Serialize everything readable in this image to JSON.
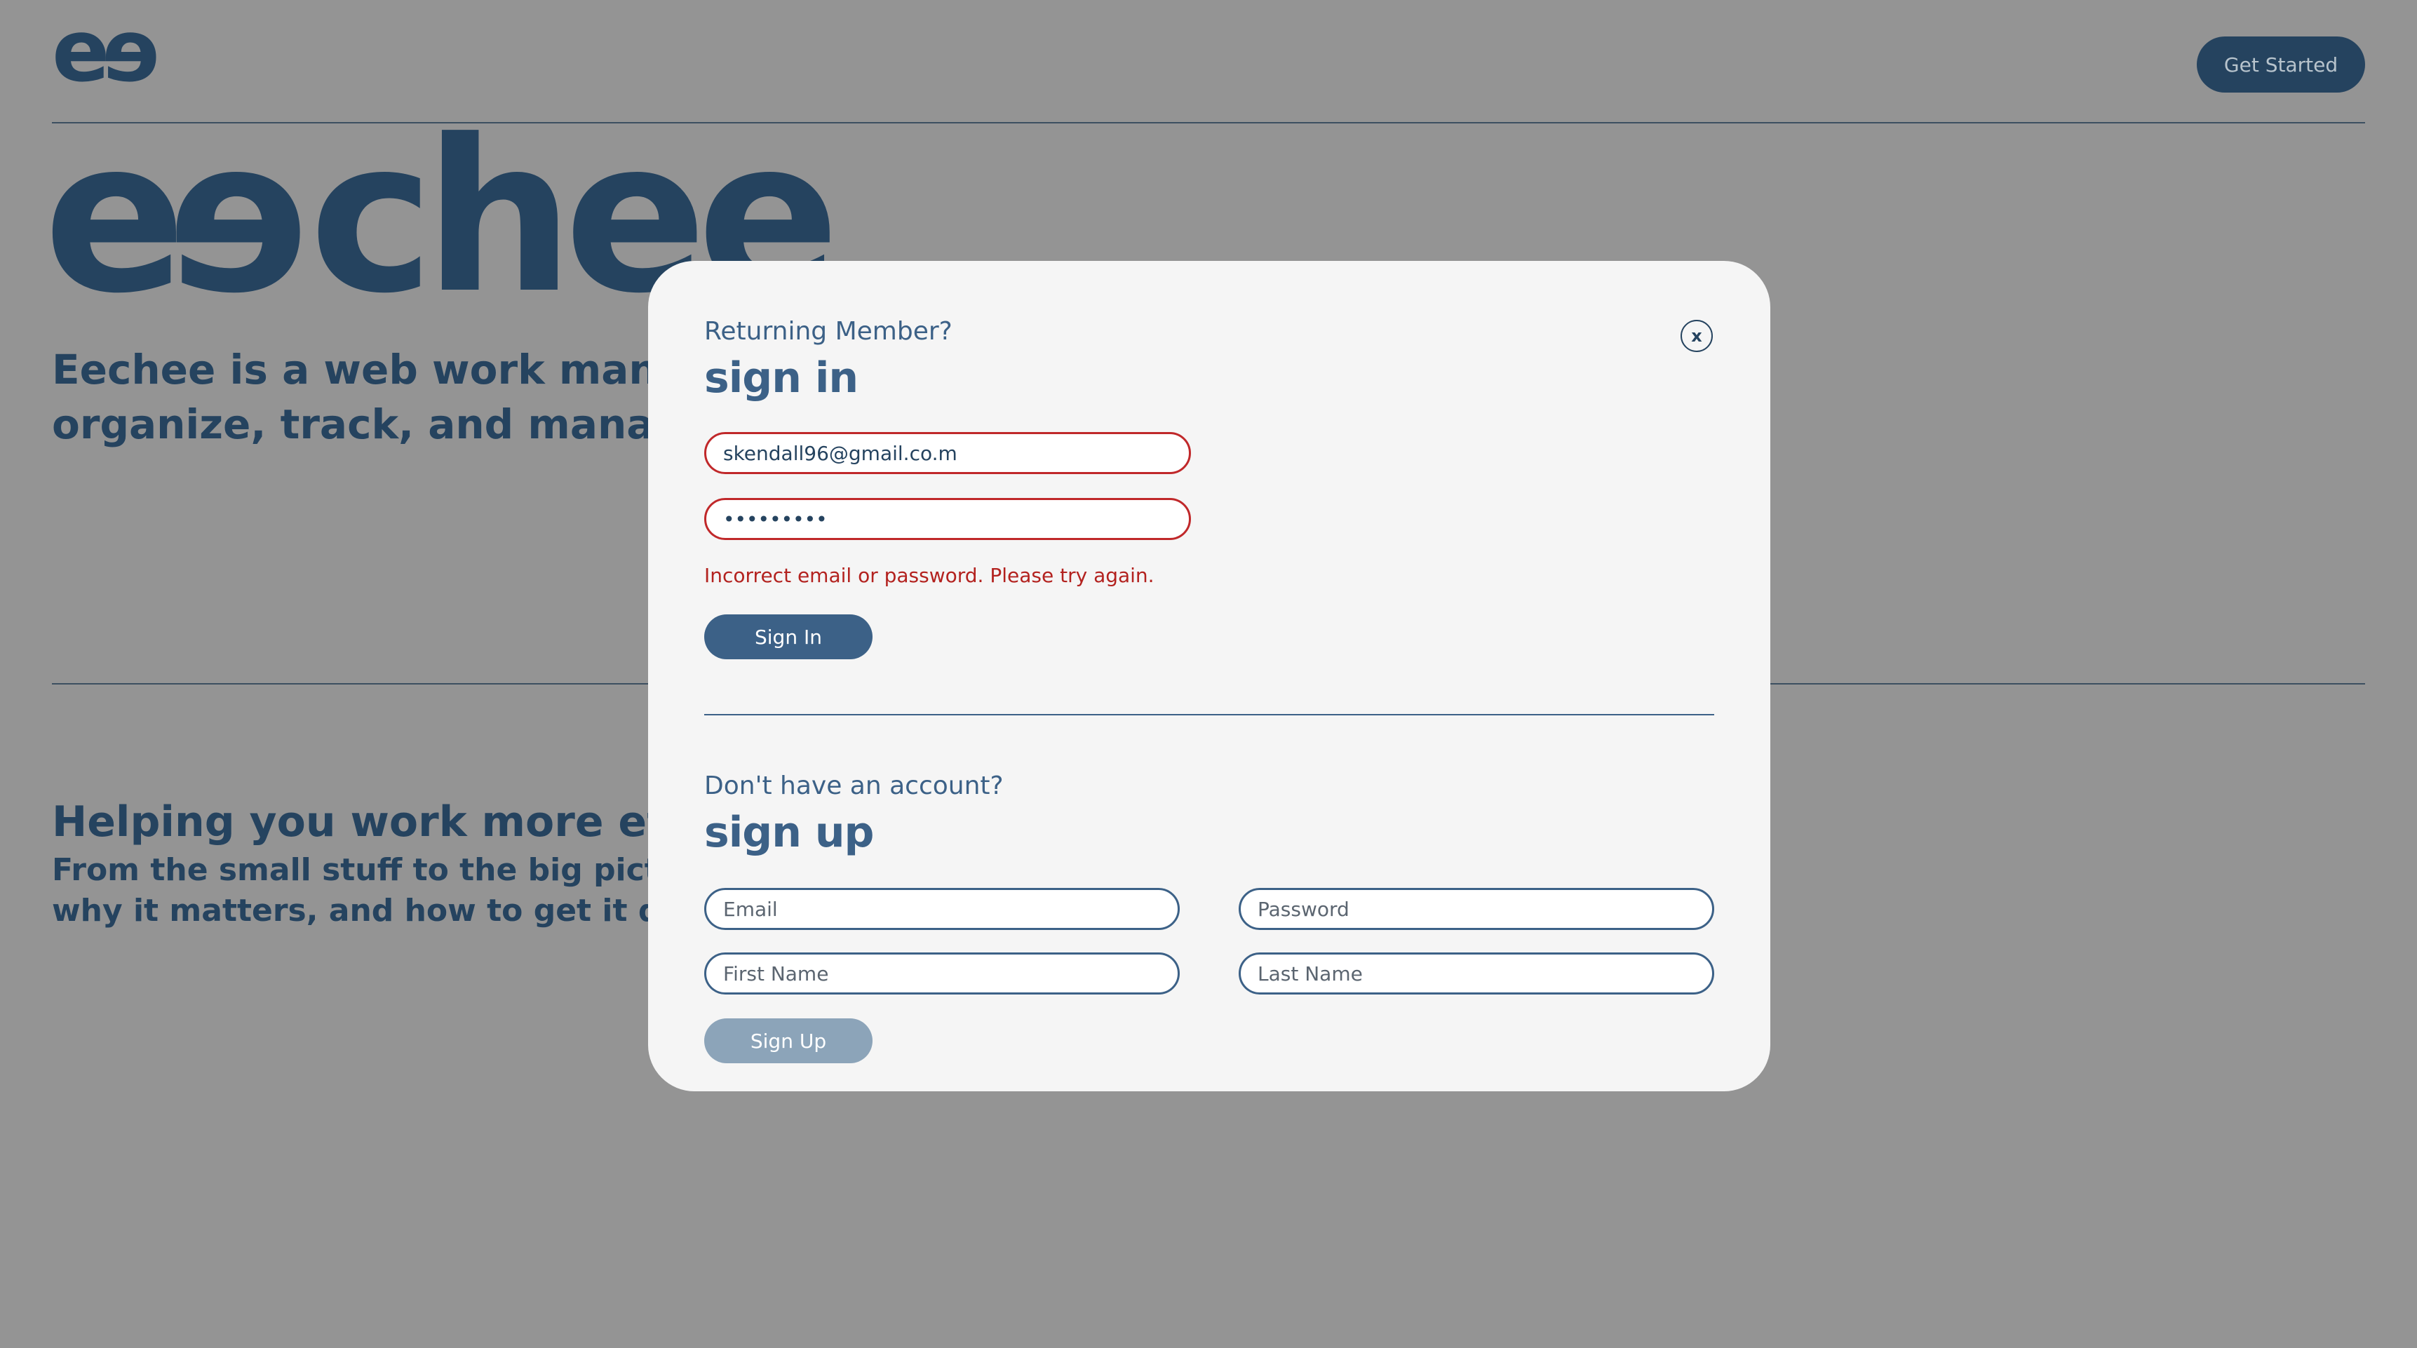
{
  "header": {
    "logo": "ee",
    "cta_label": "Get Started"
  },
  "hero": {
    "title": "eechee",
    "subtitle_line1": "Eechee is a web work manage",
    "subtitle_line2": "organize, track, and manage t"
  },
  "section": {
    "title": "Helping you work more efficie",
    "body_line1": "From the small stuff to the big picture, I",
    "body_line2": "why it matters, and how to get it done."
  },
  "modal": {
    "close_label": "x",
    "signin": {
      "eyebrow": "Returning Member?",
      "title": "sign in",
      "email_value": "skendall96@gmail.co.m",
      "password_value": "*********",
      "error": "Incorrect email or password. Please try again.",
      "button_label": "Sign In"
    },
    "signup": {
      "eyebrow": "Don't have an account?",
      "title": "sign up",
      "email_placeholder": "Email",
      "password_placeholder": "Password",
      "first_name_placeholder": "First Name",
      "last_name_placeholder": "Last Name",
      "button_label": "Sign Up"
    }
  },
  "colors": {
    "background_overlay": "#949494",
    "brand_navy": "#25435f",
    "accent_blue": "#3c6187",
    "error_red": "#c0282a",
    "modal_bg": "#f5f5f5"
  }
}
